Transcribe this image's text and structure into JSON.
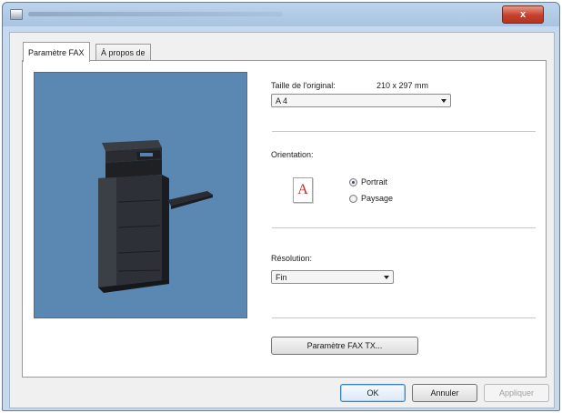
{
  "tabs": [
    {
      "label": "Paramètre FAX",
      "active": true
    },
    {
      "label": "À propos de",
      "active": false
    }
  ],
  "original_size": {
    "label": "Taille de l'original:",
    "dimension": "210 x 297 mm",
    "selected": "A 4"
  },
  "orientation": {
    "label": "Orientation:",
    "icon_letter": "A",
    "options": [
      {
        "label": "Portrait",
        "checked": true
      },
      {
        "label": "Paysage",
        "checked": false
      }
    ]
  },
  "resolution": {
    "label": "Résolution:",
    "selected": "Fin"
  },
  "fax_tx_button": "Paramètre FAX TX...",
  "footer": {
    "ok": "OK",
    "cancel": "Annuler",
    "apply": "Appliquer"
  },
  "titlebar": {
    "close_glyph": "x"
  },
  "colors": {
    "preview_background": "#5a88b3",
    "close_button": "#c4402b",
    "orientation_letter": "#c6271e"
  }
}
